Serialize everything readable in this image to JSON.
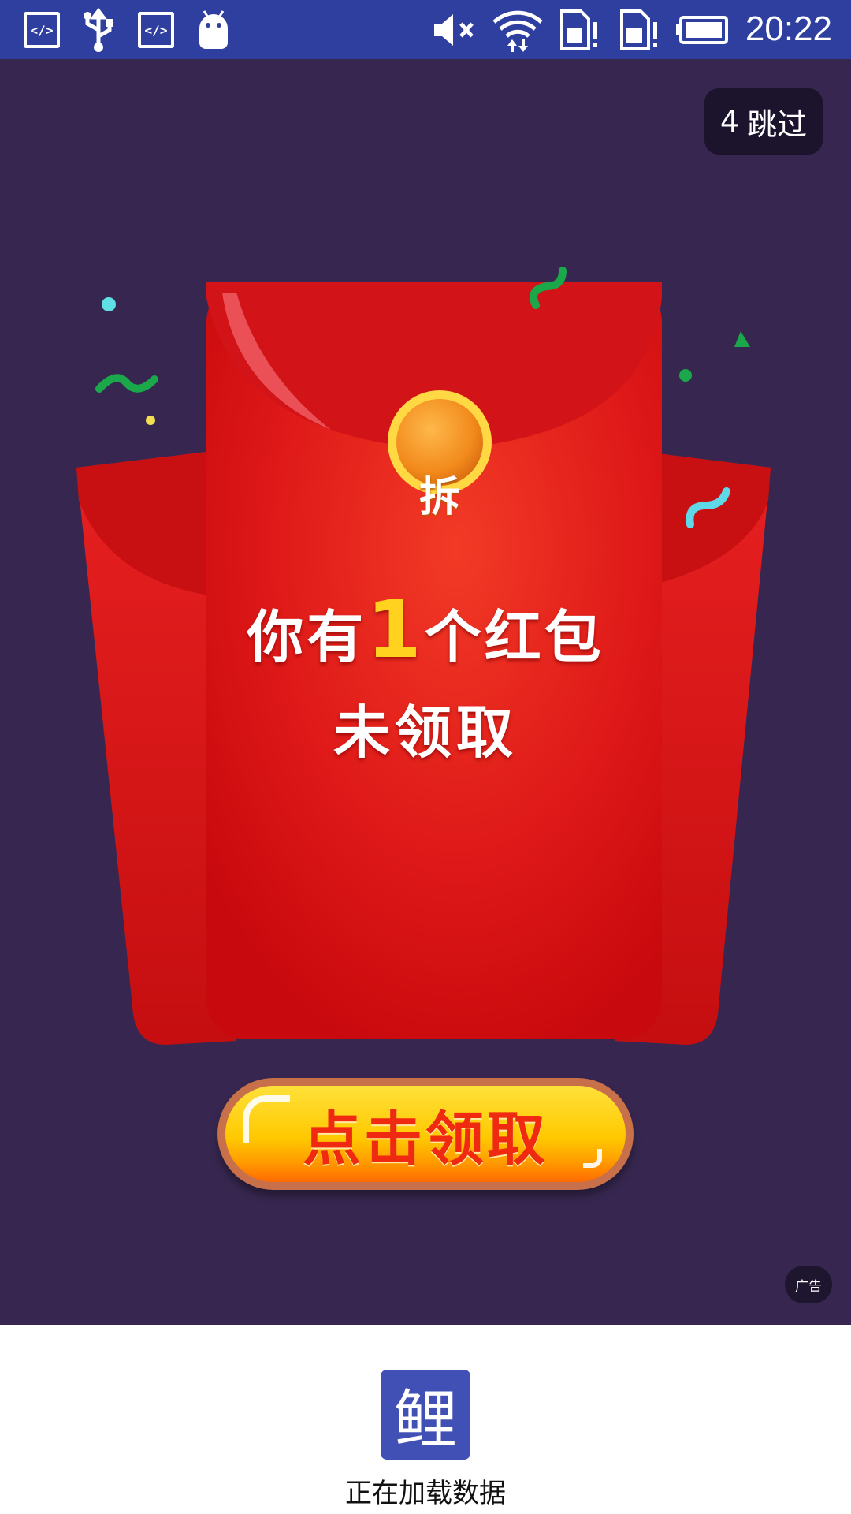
{
  "status_bar": {
    "time": "20:22",
    "icons": [
      "code-icon",
      "usb-icon",
      "code-icon",
      "android-icon",
      "mute-icon",
      "wifi-icon",
      "sim-alert-icon",
      "sim-alert-icon",
      "battery-icon"
    ],
    "code_glyph": "</>"
  },
  "ad": {
    "skip": {
      "countdown": "4",
      "label": "跳过"
    },
    "ad_badge": "广告",
    "envelope": {
      "coin_label": "拆",
      "line1_before": "你有",
      "line1_num": "1",
      "line1_after": "个红包",
      "line2": "未领取"
    },
    "claim_button": "点击领取"
  },
  "app": {
    "logo_char": "鲤",
    "loading_text": "正在加载数据"
  },
  "colors": {
    "status_bar": "#2e3fa0",
    "ad_background": "#372750",
    "envelope_red": "#e21c1c",
    "button_yellow": "#ffc800",
    "logo_blue": "#4150b5"
  }
}
